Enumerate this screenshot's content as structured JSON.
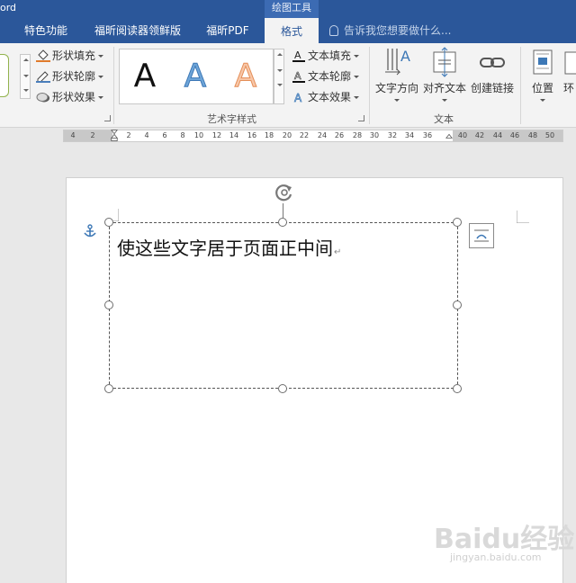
{
  "titlebar": {
    "app_title": "ord",
    "context_tab": "绘图工具"
  },
  "tabs": [
    {
      "label": "特色功能"
    },
    {
      "label": "福昕阅读器领鲜版"
    },
    {
      "label": "福昕PDF"
    },
    {
      "label": "格式"
    }
  ],
  "tell_me": {
    "placeholder": "告诉我您想要做什么..."
  },
  "shape_styles": {
    "fill": "形状填充",
    "outline": "形状轮廓",
    "effects": "形状效果"
  },
  "wordart": {
    "group_label": "艺术字样式",
    "samples": [
      "A",
      "A",
      "A"
    ],
    "text_fill": "文本填充",
    "text_outline": "文本轮廓",
    "text_effects": "文本效果"
  },
  "text_group": {
    "group_label": "文本",
    "direction": "文字方向",
    "align": "对齐文本",
    "link": "创建链接"
  },
  "arrange": {
    "position": "位置",
    "wrap_partial": "环"
  },
  "ruler": {
    "ticks": [
      "4",
      "2",
      "2",
      "4",
      "6",
      "8",
      "10",
      "12",
      "14",
      "16",
      "18",
      "20",
      "22",
      "24",
      "26",
      "28",
      "30",
      "32",
      "34",
      "36",
      "40",
      "42",
      "44",
      "46",
      "48",
      "50"
    ]
  },
  "document": {
    "textbox_text": "使这些文字居于页面正中间",
    "para_mark": "↵"
  },
  "watermark": {
    "text": "Baidu经验",
    "sub": "jingyan.baidu.com"
  },
  "colors": {
    "accent": "#2b579a",
    "context_tab": "#3c6bb3",
    "ribbon_bg": "#f3f3f3"
  }
}
